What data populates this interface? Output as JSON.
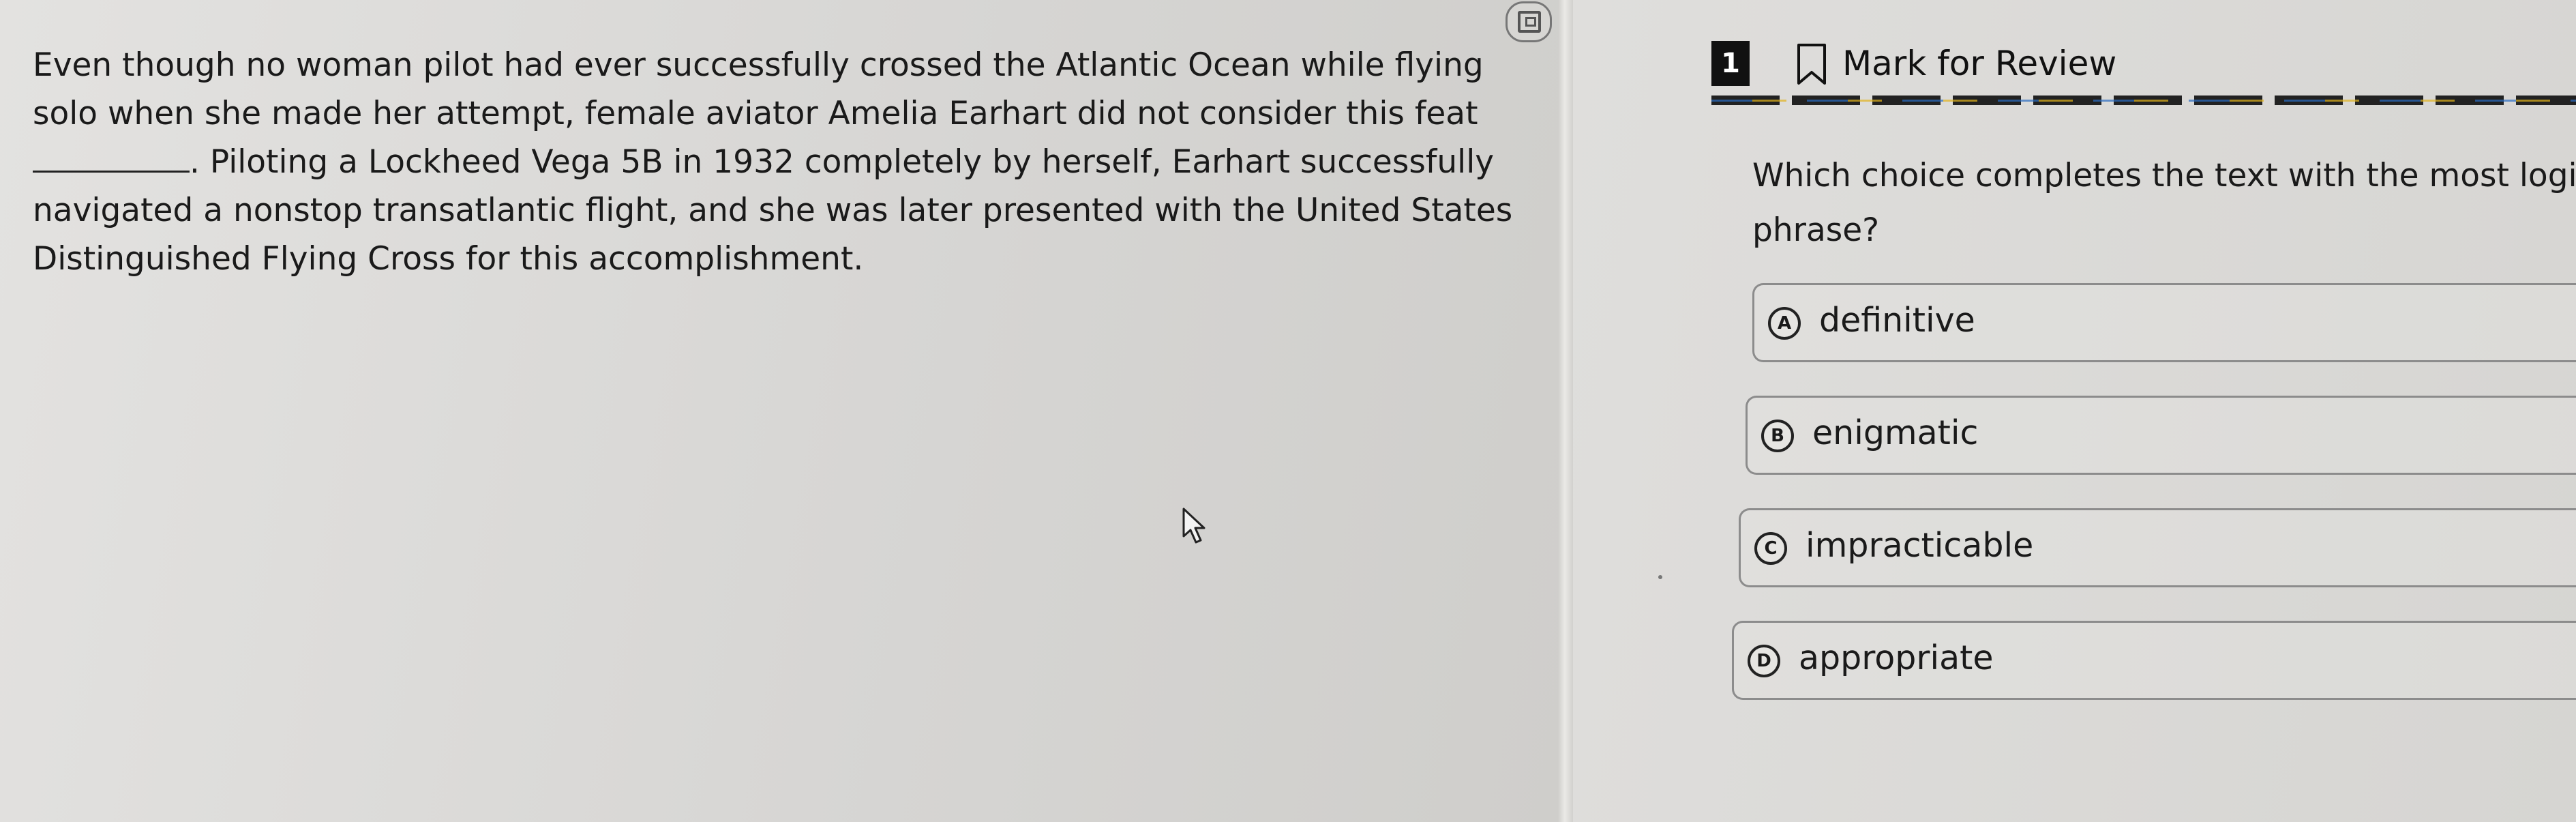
{
  "passage": {
    "text_before_blank": "Even though no woman pilot had ever successfully crossed the Atlantic Ocean while flying solo when she made her attempt, female aviator Amelia Earhart did not consider this feat",
    "text_after_blank": ". Piloting a Lockheed Vega 5B in 1932 completely by herself, Earhart successfully navigated a nonstop transatlantic flight, and she was later presented with the United States Distinguished Flying Cross for this accomplishment."
  },
  "toolbar": {
    "icons": [
      "collapse-pane-icon",
      "expand-pane-icon"
    ]
  },
  "question": {
    "number": "1",
    "mark_for_review_label": "Mark for Review",
    "prompt": "Which choice completes the text with the most logi phrase?",
    "choices": [
      {
        "letter": "A",
        "text": "definitive"
      },
      {
        "letter": "B",
        "text": "enigmatic"
      },
      {
        "letter": "C",
        "text": "impracticable"
      },
      {
        "letter": "D",
        "text": "appropriate"
      }
    ]
  },
  "colors": {
    "background": "#d9d8d6",
    "text": "#1a1a1a",
    "question_number_bg": "#111111",
    "accent_blue": "#2a6cc2",
    "accent_yellow": "#e2b31d"
  }
}
